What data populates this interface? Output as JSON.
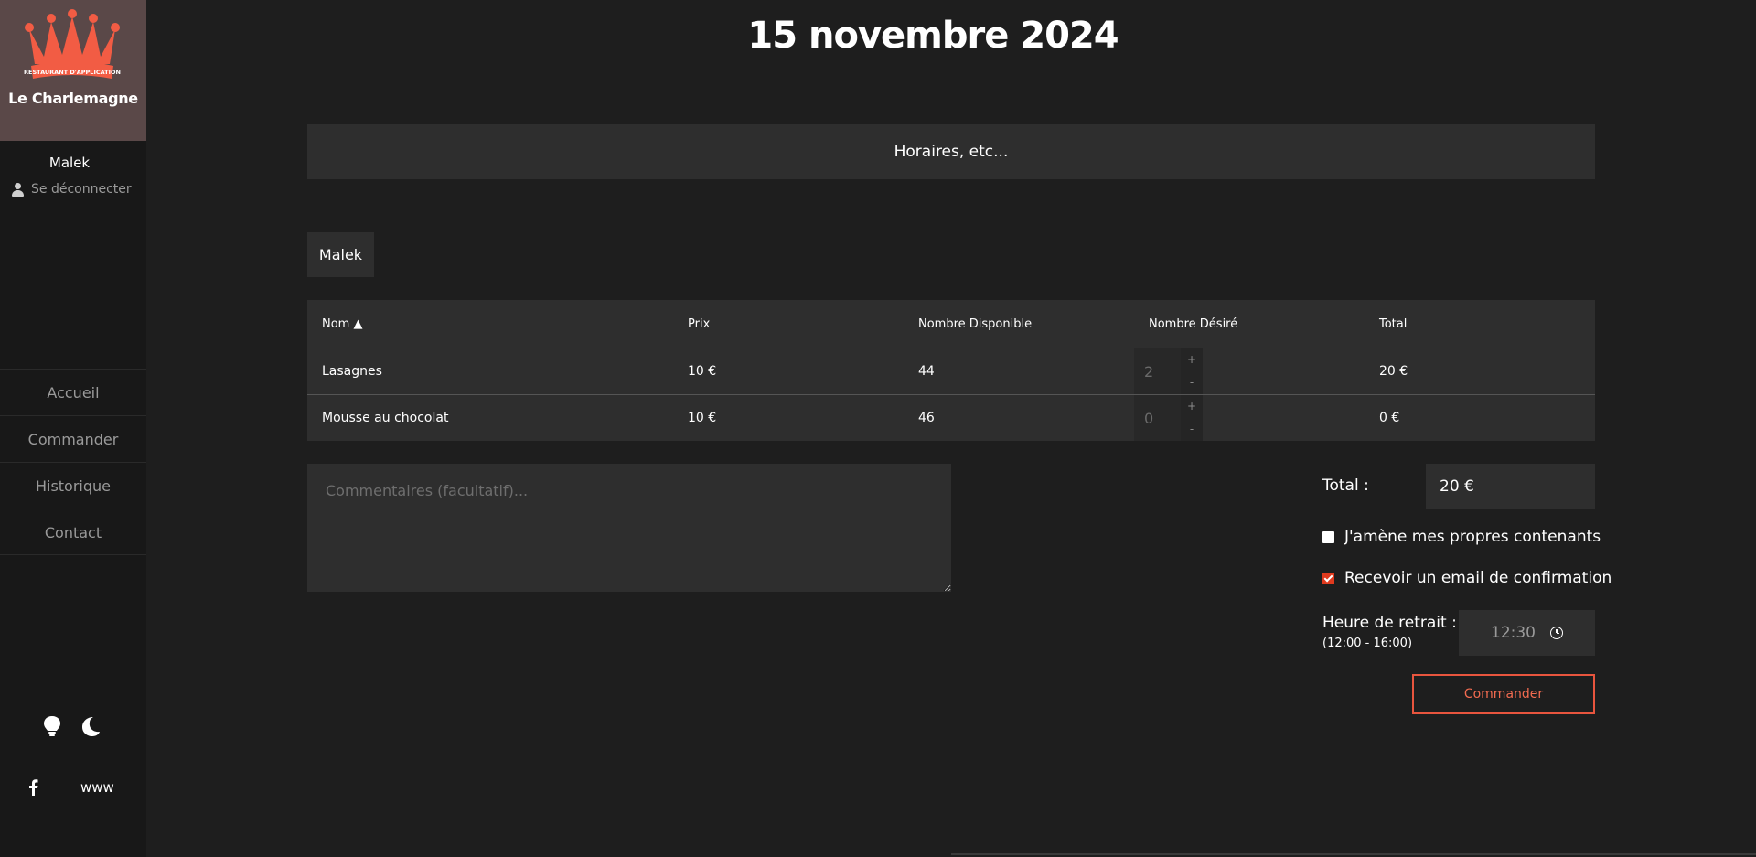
{
  "brand": {
    "name": "Le Charlemagne",
    "badge_text": "RESTAURANT D'APPLICATION",
    "accent_color": "#f25c44"
  },
  "user": {
    "name": "Malek",
    "logout_label": "Se déconnecter"
  },
  "nav": {
    "items": [
      {
        "label": "Accueil"
      },
      {
        "label": "Commander"
      },
      {
        "label": "Historique"
      },
      {
        "label": "Contact"
      }
    ]
  },
  "footer": {
    "theme_icons": [
      "lightbulb-icon",
      "moon-icon"
    ],
    "social_icon": "facebook-icon",
    "website_label": "www"
  },
  "page": {
    "title": "15 novembre 2024",
    "hours_label": "Horaires, etc...",
    "user_tab": "Malek"
  },
  "table": {
    "headers": {
      "name": "Nom ▲",
      "price": "Prix",
      "available": "Nombre Disponible",
      "desired": "Nombre Désiré",
      "total": "Total"
    },
    "rows": [
      {
        "name": "Lasagnes",
        "price": "10 €",
        "available": "44",
        "desired": "2",
        "total": "20 €"
      },
      {
        "name": "Mousse au chocolat",
        "price": "10 €",
        "available": "46",
        "desired": "0",
        "total": "0 €"
      }
    ],
    "step_up": "+",
    "step_down": "-"
  },
  "order": {
    "comments_placeholder": "Commentaires (facultatif)...",
    "total_label": "Total :",
    "total_value": "20 €",
    "own_containers_label": "J'amène mes propres contenants",
    "own_containers_checked": false,
    "email_confirm_label": "Recevoir un email de confirmation",
    "email_confirm_checked": true,
    "pickup_label": "Heure de retrait :",
    "pickup_range": "(12:00 - 16:00)",
    "pickup_time": "12:30",
    "submit_label": "Commander"
  }
}
